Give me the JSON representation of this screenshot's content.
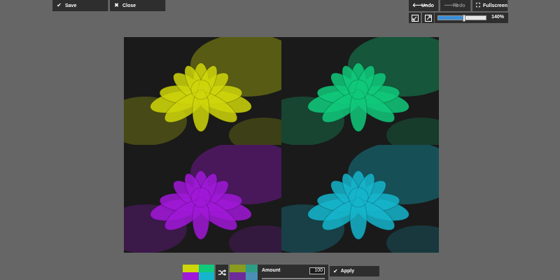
{
  "toolbar": {
    "save": {
      "label": "Save",
      "icon": "check-icon"
    },
    "close": {
      "label": "Close",
      "icon": "close-icon"
    },
    "undo": {
      "label": "Undo",
      "icon": "arrow-left-icon"
    },
    "redo": {
      "label": "Redo",
      "icon": "arrow-right-icon"
    },
    "fullscreen": {
      "label": "Fullscreen",
      "icon": "fullscreen-icon"
    }
  },
  "zoom": {
    "value": "140%",
    "level": 0.55,
    "icons": [
      "zoom-out-icon",
      "zoom-in-icon"
    ]
  },
  "canvas": {
    "tints": [
      {
        "name": "yellow",
        "color": "#cfd60a"
      },
      {
        "name": "green",
        "color": "#10c97a"
      },
      {
        "name": "purple",
        "color": "#a018d8"
      },
      {
        "name": "cyan",
        "color": "#15b5cc"
      }
    ]
  },
  "filter_panel": {
    "amount_label": "Amount",
    "amount_value": "100",
    "apply_label": "Apply",
    "shuffle_icon": "shuffle-icon"
  }
}
